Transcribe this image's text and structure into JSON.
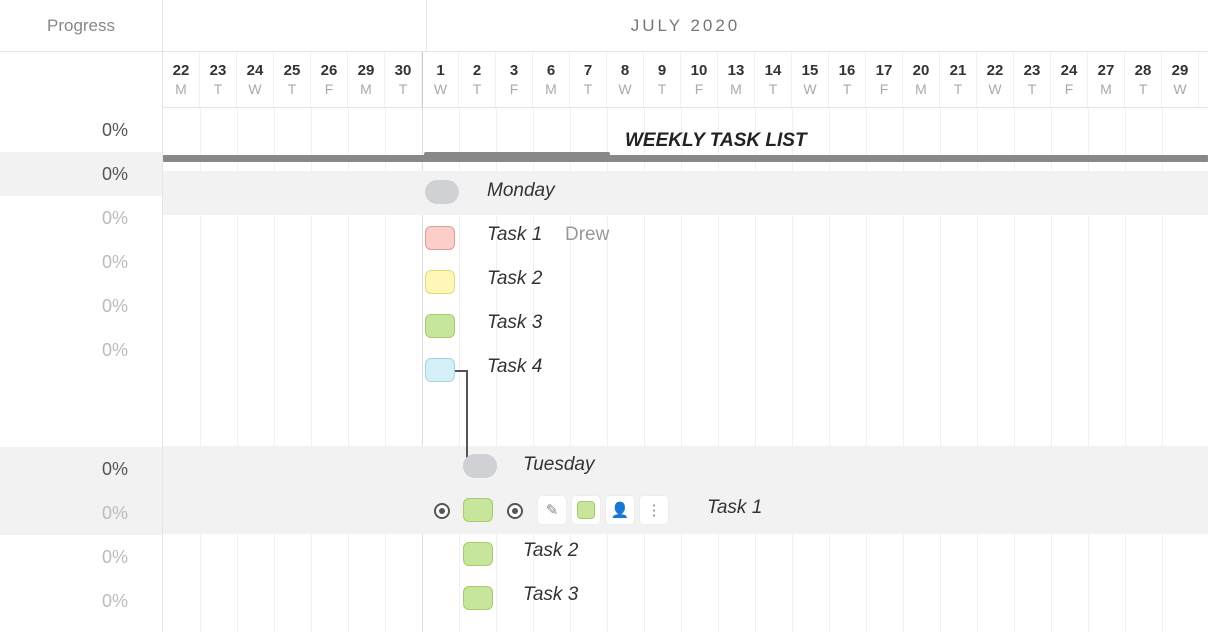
{
  "left": {
    "header": "Progress",
    "rows": [
      {
        "value": "0%",
        "dark": true,
        "shaded": false
      },
      {
        "value": "0%",
        "dark": true,
        "shaded": true
      },
      {
        "value": "0%",
        "dark": false,
        "shaded": false
      },
      {
        "value": "0%",
        "dark": false,
        "shaded": false
      },
      {
        "value": "0%",
        "dark": false,
        "shaded": false
      },
      {
        "value": "0%",
        "dark": false,
        "shaded": false
      },
      {
        "value": "",
        "dark": false,
        "shaded": false
      },
      {
        "value": "0%",
        "dark": true,
        "shaded": true
      },
      {
        "value": "0%",
        "dark": false,
        "shaded": true
      },
      {
        "value": "0%",
        "dark": false,
        "shaded": false
      },
      {
        "value": "0%",
        "dark": false,
        "shaded": false
      }
    ]
  },
  "header": {
    "month": "JULY 2020"
  },
  "days": [
    {
      "num": "22",
      "d": "M"
    },
    {
      "num": "23",
      "d": "T"
    },
    {
      "num": "24",
      "d": "W"
    },
    {
      "num": "25",
      "d": "T"
    },
    {
      "num": "26",
      "d": "F"
    },
    {
      "num": "29",
      "d": "M"
    },
    {
      "num": "30",
      "d": "T"
    },
    {
      "num": "1",
      "d": "W"
    },
    {
      "num": "2",
      "d": "T"
    },
    {
      "num": "3",
      "d": "F"
    },
    {
      "num": "6",
      "d": "M"
    },
    {
      "num": "7",
      "d": "T"
    },
    {
      "num": "8",
      "d": "W"
    },
    {
      "num": "9",
      "d": "T"
    },
    {
      "num": "10",
      "d": "F"
    },
    {
      "num": "13",
      "d": "M"
    },
    {
      "num": "14",
      "d": "T"
    },
    {
      "num": "15",
      "d": "W"
    },
    {
      "num": "16",
      "d": "T"
    },
    {
      "num": "17",
      "d": "F"
    },
    {
      "num": "20",
      "d": "M"
    },
    {
      "num": "21",
      "d": "T"
    },
    {
      "num": "22",
      "d": "W"
    },
    {
      "num": "23",
      "d": "T"
    },
    {
      "num": "24",
      "d": "F"
    },
    {
      "num": "27",
      "d": "M"
    },
    {
      "num": "28",
      "d": "T"
    },
    {
      "num": "29",
      "d": "W"
    }
  ],
  "chart": {
    "title": "WEEKLY TASK LIST",
    "section1": "Monday",
    "task1": "Task 1",
    "task1_assignee": "Drew",
    "task2": "Task 2",
    "task3a": "Task 3",
    "task4": "Task 4",
    "section2": "Tuesday",
    "task5": "Task 1",
    "task6": "Task 2",
    "task7": "Task 3"
  }
}
